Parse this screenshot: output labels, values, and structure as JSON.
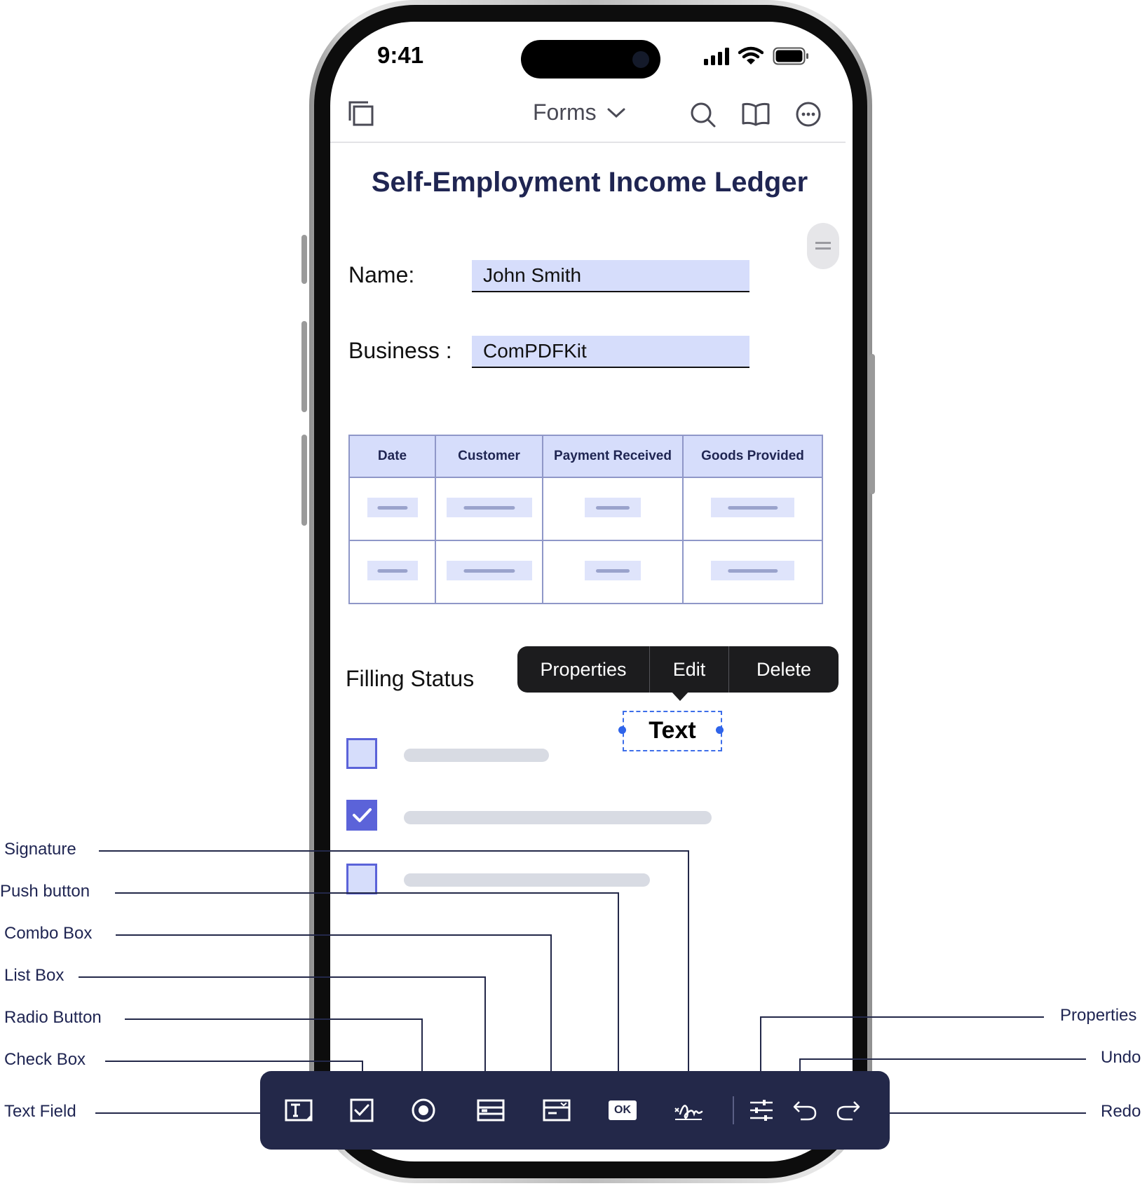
{
  "status_bar": {
    "time": "9:41"
  },
  "nav": {
    "title": "Forms"
  },
  "document": {
    "title": "Self-Employment Income Ledger",
    "name_label": "Name:",
    "name_value": "John Smith",
    "business_label": "Business :",
    "business_value": "ComPDFKit",
    "table_headers": [
      "Date",
      "Customer",
      "Payment Received",
      "Goods Provided"
    ],
    "filling_status_label": "Filling Status"
  },
  "context_menu": {
    "items": [
      "Properties",
      "Edit",
      "Delete"
    ]
  },
  "selected_annotation": {
    "text": "Text"
  },
  "checkboxes": [
    {
      "checked": false
    },
    {
      "checked": true
    },
    {
      "checked": false
    }
  ],
  "toolbar": {
    "tools": [
      "text-field",
      "check-box",
      "radio-button",
      "list-box",
      "combo-box",
      "push-button",
      "signature",
      "properties",
      "undo",
      "redo"
    ],
    "push_button_text": "OK"
  },
  "callouts": {
    "signature": "Signature",
    "push_button": "Push button",
    "combo_box": "Combo Box",
    "list_box": "List Box",
    "radio_button": "Radio Button",
    "check_box": "Check Box",
    "text_field": "Text Field",
    "properties": "Properties",
    "undo": "Undo",
    "redo": "Redo"
  },
  "colors": {
    "accent": "#5b63d9",
    "field_fill": "#d6ddfb",
    "toolbar_bg": "#232849",
    "title_color": "#1f2552"
  }
}
